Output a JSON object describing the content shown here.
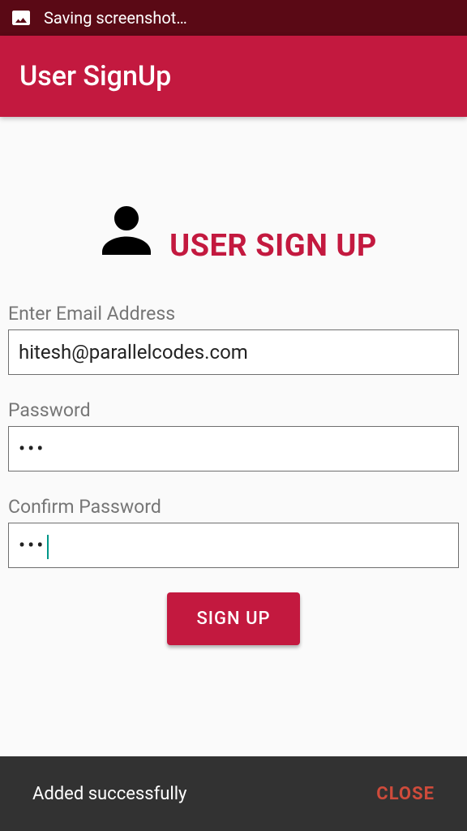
{
  "status_bar": {
    "saving_text": "Saving screenshot…"
  },
  "app_bar": {
    "title": "User SignUp"
  },
  "hero": {
    "title": "USER SIGN UP"
  },
  "form": {
    "email_label": "Enter Email Address",
    "email_value": "hitesh@parallelcodes.com",
    "password_label": "Password",
    "password_mask": "•••",
    "confirm_label": "Confirm Password",
    "confirm_mask": "•••",
    "signup_button": "SIGN UP"
  },
  "snackbar": {
    "message": "Added successfully",
    "action": "CLOSE"
  }
}
